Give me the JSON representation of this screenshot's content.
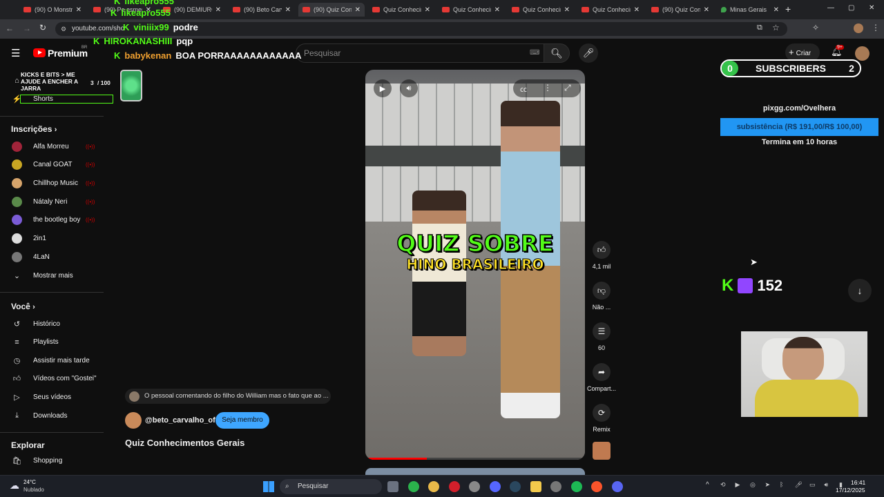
{
  "tabs": [
    {
      "title": "(90) O Monstr",
      "active": false
    },
    {
      "title": "(90) Pe esmer",
      "active": false
    },
    {
      "title": "(90) DEMIURG",
      "active": false
    },
    {
      "title": "(90) Beto Carva",
      "active": false
    },
    {
      "title": "(90) Quiz Conh",
      "active": true
    },
    {
      "title": "Quiz Conhecim",
      "active": false
    },
    {
      "title": "Quiz Conhecim",
      "active": false
    },
    {
      "title": "Quiz Conhecim",
      "active": false
    },
    {
      "title": "Quiz Conhecim",
      "active": false
    },
    {
      "title": "(90) Quiz Conh",
      "active": false
    },
    {
      "title": "Minas Gerais",
      "active": false
    }
  ],
  "address": {
    "url": "youtube.com/sho"
  },
  "youtube": {
    "brand": "Premium",
    "brand_region": "BR",
    "search_placeholder": "Pesquisar",
    "create_label": "Criar",
    "notif_badge": "9+"
  },
  "sidebar": {
    "shorts_label": "Shorts",
    "subscriptions_heading": "Inscrições",
    "subscriptions": [
      {
        "name": "Alfa Morreu",
        "live": true,
        "color": "#a0243a"
      },
      {
        "name": "Canal GOAT",
        "live": true,
        "color": "#c8a623"
      },
      {
        "name": "Chillhop Music",
        "live": true,
        "color": "#d6a46b"
      },
      {
        "name": "Nátaly Neri",
        "live": true,
        "color": "#5a8a4a"
      },
      {
        "name": "the bootleg boy",
        "live": true,
        "color": "#7b5cd6"
      },
      {
        "name": "2in1",
        "live": false,
        "color": "#dddddd"
      },
      {
        "name": "4LaN",
        "live": false,
        "color": "#777777"
      }
    ],
    "show_more": "Mostrar mais",
    "you_heading": "Você",
    "you_items": [
      {
        "label": "Histórico",
        "icon": "history-icon"
      },
      {
        "label": "Playlists",
        "icon": "playlists-icon"
      },
      {
        "label": "Assistir mais tarde",
        "icon": "watch-later-icon"
      },
      {
        "label": "Vídeos com \"Gostei\"",
        "icon": "liked-icon"
      },
      {
        "label": "Seus vídeos",
        "icon": "your-videos-icon"
      },
      {
        "label": "Downloads",
        "icon": "download-icon"
      }
    ],
    "explore_heading": "Explorar",
    "explore_items": [
      {
        "label": "Shopping",
        "icon": "shopping-icon"
      }
    ]
  },
  "goal_widget": {
    "title": "KICKS E BITS > ME AJUDE A ENCHER A JARRA",
    "count": "3",
    "total": "/ 100"
  },
  "chat": [
    {
      "user": "likeapro555",
      "message": "",
      "user_color": "#53fc18"
    },
    {
      "user": "likeapro555",
      "message": "",
      "user_color": "#53fc18"
    },
    {
      "user": "viniiix99",
      "message": "podre",
      "user_color": "#53fc18"
    },
    {
      "user": "HIROKANASHIII",
      "message": "pqp",
      "user_color": "#53fc18"
    },
    {
      "user": "babykenan",
      "message": "BOA PORRAAAAAAAAAAAA",
      "user_color": "#f0a030"
    }
  ],
  "video": {
    "overlay_line1": "QUIZ SOBRE",
    "overlay_line2": "HINO BRASILEIRO",
    "progress": 0.28,
    "title": "Quiz Conhecimentos Gerais",
    "channel": "@beto_carvalho_ofc",
    "join_label": "Seja membro",
    "comment_preview": "O pessoal comentando do filho do William mas o fato que ao ..."
  },
  "actions": {
    "like_count": "4,1 mil",
    "dislike_label": "Não ...",
    "comments_count": "60",
    "share_label": "Compart...",
    "remix_label": "Remix"
  },
  "stream_overlay": {
    "subs_left": "0",
    "subs_title": "SUBSCRIBERS",
    "subs_right": "2",
    "goal_url": "pixgg.com/Ovelhera",
    "goal_bar_text": "subsistência (R$ 191,00/R$ 100,00)",
    "goal_ends": "Termina em 10 horas",
    "viewers": "152",
    "kick_color": "#53fc18",
    "twitch_color": "#9146ff"
  },
  "taskbar": {
    "weather_temp": "24°C",
    "weather_desc": "Nublado",
    "search_placeholder": "Pesquisar",
    "time": "16:41",
    "date": "17/12/2025"
  }
}
